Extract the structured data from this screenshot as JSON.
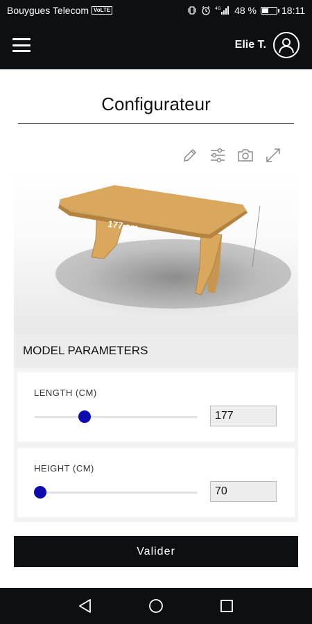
{
  "status_bar": {
    "carrier": "Bouygues Telecom",
    "volte_badge": "VoLTE",
    "battery": "48 %",
    "battery_level": 0.48,
    "time": "18:11",
    "icons": [
      "vibrate-icon",
      "alarm-icon",
      "4g-signal-icon",
      "battery-icon"
    ]
  },
  "app_bar": {
    "menu_icon": "hamburger-menu-icon",
    "user_name": "Elie T.",
    "avatar_icon": "user-avatar-icon"
  },
  "page": {
    "title": "Configurateur"
  },
  "viewer": {
    "tools": [
      "pencil-icon",
      "sliders-icon",
      "camera-icon",
      "expand-icon"
    ],
    "dimension_label": "177 cm",
    "colors": {
      "wood": "#d9a85c",
      "wood_edge": "#b5833e",
      "shadow": "#5a5a5a"
    }
  },
  "parameters": {
    "header": "MODEL PARAMETERS",
    "length": {
      "label": "LENGTH (CM)",
      "value": "177",
      "slider_position": 0.31
    },
    "height": {
      "label": "HEIGHT (CM)",
      "value": "70",
      "slider_position": 0.04
    }
  },
  "actions": {
    "submit_label": "Valider"
  },
  "nav_bar": {
    "buttons": [
      "back-triangle-icon",
      "home-circle-icon",
      "recents-square-icon"
    ]
  },
  "colors": {
    "header_bg": "#0d1013",
    "accent_thumb": "#0c0cae",
    "panel_bg": "#f3f3f3"
  }
}
